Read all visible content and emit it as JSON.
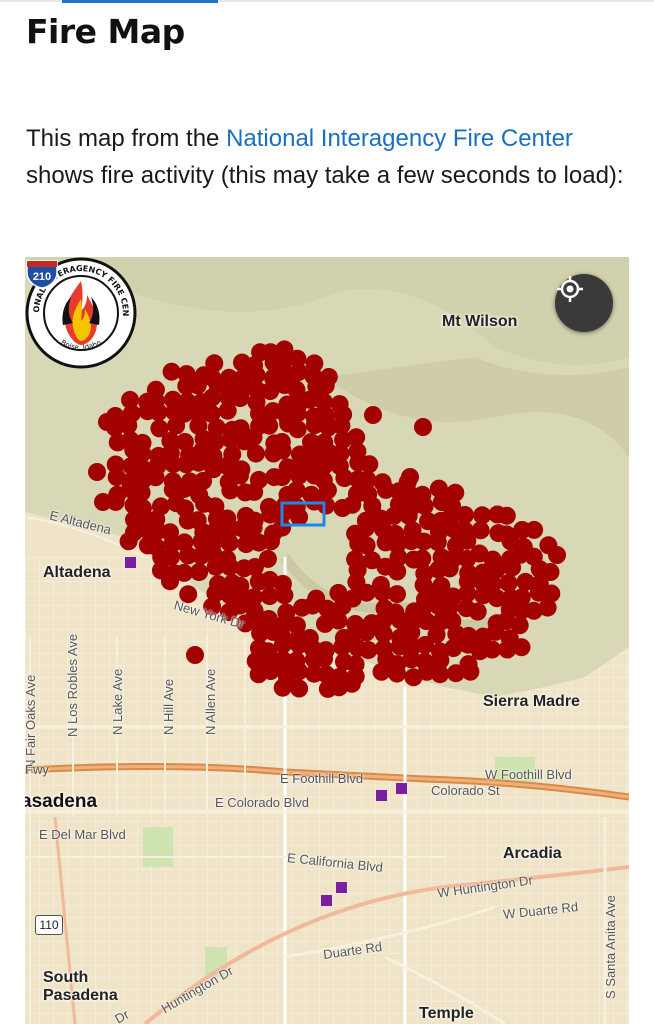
{
  "article": {
    "title": "Fire Map",
    "intro_before": "This map from the ",
    "intro_link": "National Interagency Fire Center",
    "intro_after": " shows fire activity (this may take a few seconds to load):"
  },
  "map": {
    "logo": {
      "text_top": "NATIONAL INTERAGENCY FIRE CENTER",
      "text_bottom": "Boise, Idaho"
    },
    "locate_icon": "crosshair-locate-icon",
    "places": {
      "mt_wilson": "Mt Wilson",
      "altadena": "Altadena",
      "sierra_madre": "Sierra Madre",
      "pasadena": "asadena",
      "arcadia": "Arcadia",
      "south_pasadena": "South Pasadena",
      "temple": "Temple"
    },
    "roads": {
      "e_altadena": "E Altadena",
      "new_york": "New York Dr",
      "fair_oaks": "N Fair Oaks Ave",
      "los_robles": "N Los Robles Ave",
      "lake": "N Lake Ave",
      "hill": "N Hill Ave",
      "allen": "N Allen Ave",
      "fwy": "Fwy",
      "e_foothill": "E Foothill Blvd",
      "w_foothill": "W Foothill Blvd",
      "e_colorado": "E Colorado Blvd",
      "colorado_st": "Colorado St",
      "e_del_mar": "E Del Mar Blvd",
      "e_california": "E California Blvd",
      "w_huntington": "W Huntington Dr",
      "w_duarte": "W Duarte Rd",
      "duarte": "Duarte Rd",
      "huntington": "Huntington Dr",
      "santa_anita": "S Santa Anita Ave",
      "dr": "Dr"
    },
    "shields": {
      "i210": "210",
      "sr110": "110"
    },
    "colors": {
      "fire_detection": "#a30000",
      "purple_marker": "#7b1fa2",
      "selection": "#1e88e5",
      "mountains": "#d6d6b6",
      "urban": "#efe4c8"
    }
  }
}
